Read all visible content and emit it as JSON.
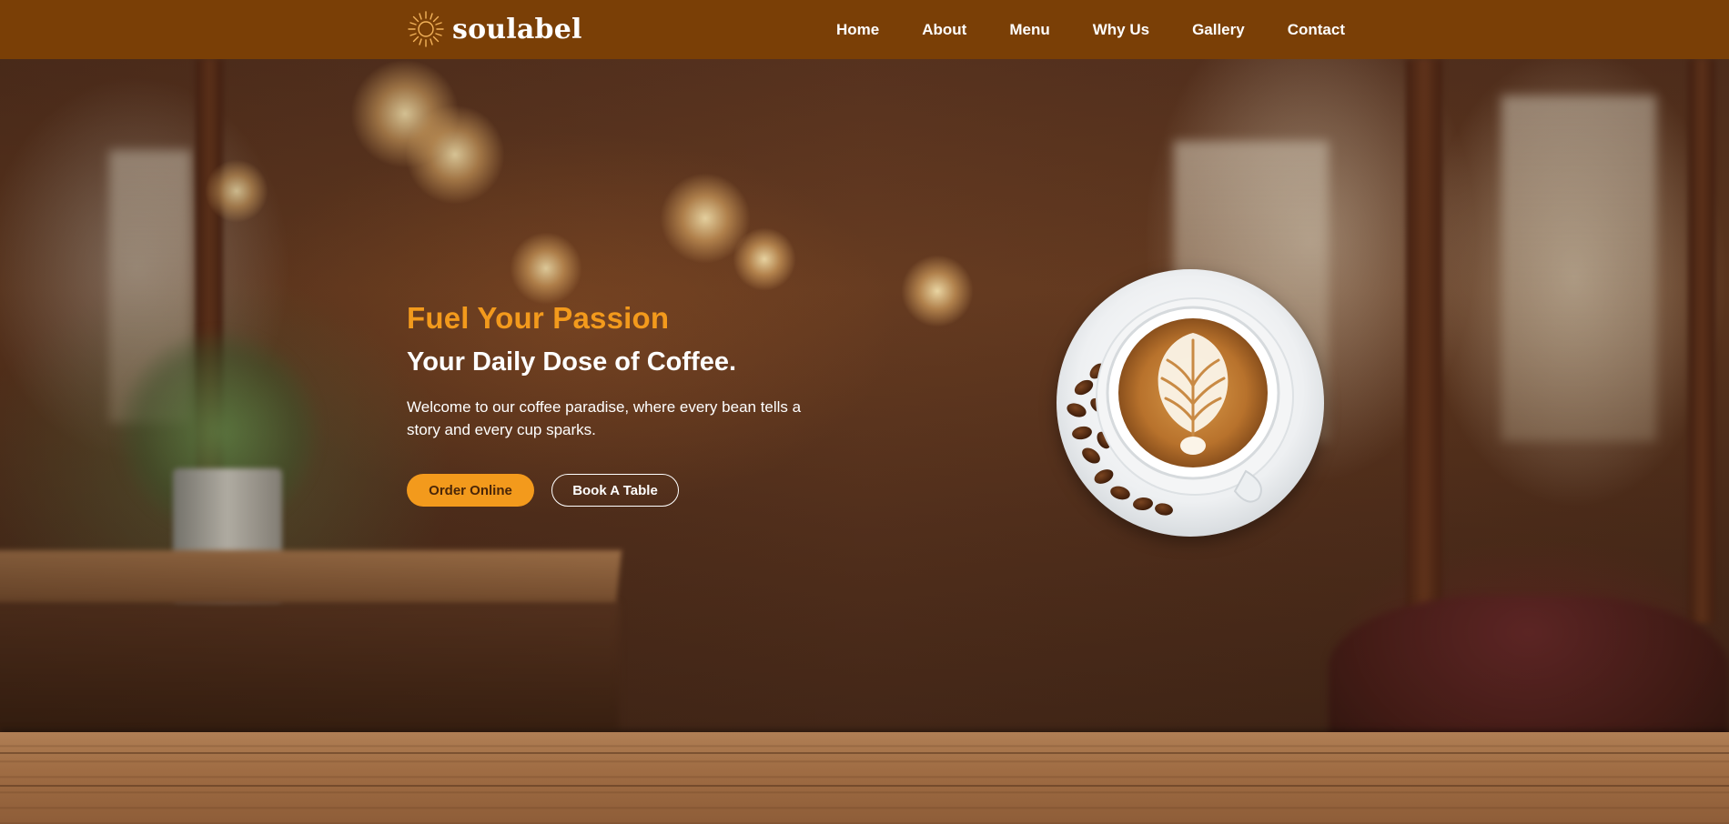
{
  "brand": {
    "name": "soulabel",
    "logo_icon": "sun-icon"
  },
  "nav": {
    "items": [
      {
        "label": "Home"
      },
      {
        "label": "About"
      },
      {
        "label": "Menu"
      },
      {
        "label": "Why Us"
      },
      {
        "label": "Gallery"
      },
      {
        "label": "Contact"
      }
    ]
  },
  "hero": {
    "tagline": "Fuel Your Passion",
    "title": "Your Daily Dose of Coffee.",
    "description": "Welcome to our coffee paradise, where every bean tells a story and every cup sparks.",
    "primary_button": "Order Online",
    "secondary_button": "Book A Table",
    "image": "latte-art-coffee-cup"
  },
  "colors": {
    "navbar_bg": "#7a3f06",
    "accent": "#f39a1c",
    "text_light": "#ffffff"
  }
}
